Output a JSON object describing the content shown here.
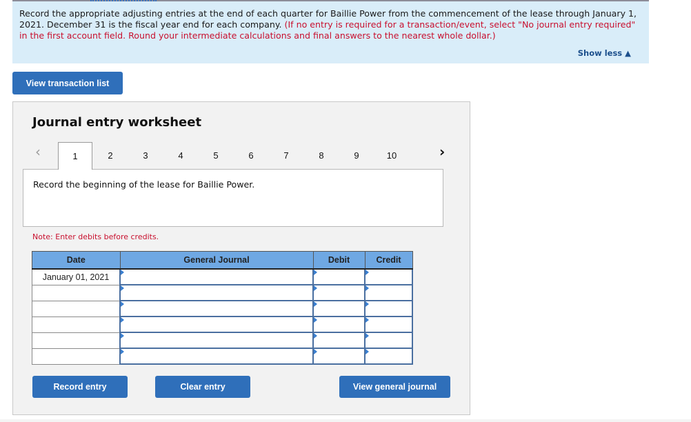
{
  "instructions": {
    "text_black": "Record the appropriate adjusting  entries at the end of each quarter for Baillie Power from the commencement of the lease through January 1, 2021. December 31 is the fiscal year end for each company. ",
    "text_red": "(If no entry is required for a transaction/event, select \"No journal entry required\" in the first account field. Round your intermediate calculations and final answers to the nearest whole dollar.)",
    "show_less": "Show less ▲"
  },
  "buttons": {
    "view_transaction_list": "View transaction list",
    "record_entry": "Record entry",
    "clear_entry": "Clear entry",
    "view_general_journal": "View general journal"
  },
  "worksheet": {
    "title": "Journal entry worksheet",
    "prev_icon": "‹",
    "next_icon": "›",
    "tabs": [
      "1",
      "2",
      "3",
      "4",
      "5",
      "6",
      "7",
      "8",
      "9",
      "10"
    ],
    "active_tab": "1",
    "description": "Record the beginning of the lease for Baillie Power.",
    "note": "Note: Enter debits before credits.",
    "table": {
      "headers": [
        "Date",
        "General Journal",
        "Debit",
        "Credit"
      ],
      "rows": [
        {
          "date": "January 01, 2021",
          "account": "",
          "debit": "",
          "credit": ""
        },
        {
          "date": "",
          "account": "",
          "debit": "",
          "credit": ""
        },
        {
          "date": "",
          "account": "",
          "debit": "",
          "credit": ""
        },
        {
          "date": "",
          "account": "",
          "debit": "",
          "credit": ""
        },
        {
          "date": "",
          "account": "",
          "debit": "",
          "credit": ""
        },
        {
          "date": "",
          "account": "",
          "debit": "",
          "credit": ""
        }
      ]
    }
  },
  "colors": {
    "accent_button": "#2f6fba",
    "instructions_bg": "#d9edf9",
    "warning_red": "#c8102e",
    "table_header": "#6fa8e3"
  }
}
